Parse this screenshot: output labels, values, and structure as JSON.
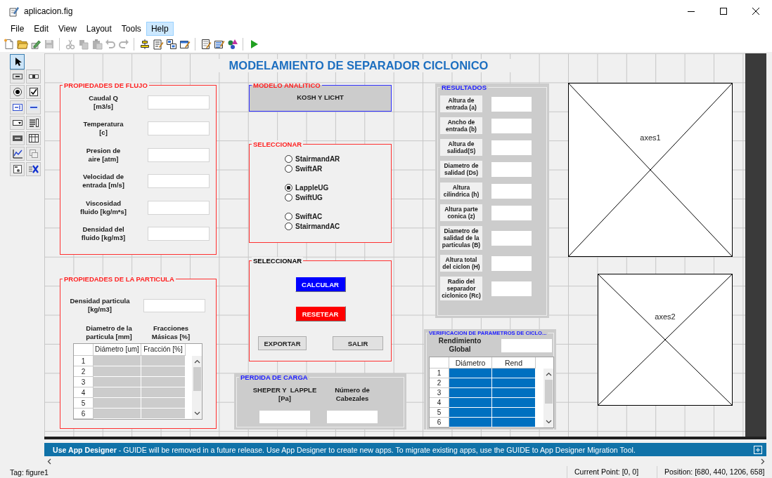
{
  "window": {
    "title": "aplicacion.fig"
  },
  "menu": [
    {
      "label": "File",
      "selected": false
    },
    {
      "label": "Edit",
      "selected": false
    },
    {
      "label": "View",
      "selected": false
    },
    {
      "label": "Layout",
      "selected": false
    },
    {
      "label": "Tools",
      "selected": false
    },
    {
      "label": "Help",
      "selected": true
    }
  ],
  "toolbar": [
    {
      "items": [
        {
          "kind": "new",
          "disabled": false
        },
        {
          "kind": "open",
          "disabled": false
        },
        {
          "kind": "launch",
          "disabled": false
        },
        {
          "kind": "save",
          "disabled": true
        }
      ]
    },
    {
      "items": [
        {
          "kind": "cut",
          "disabled": true
        },
        {
          "kind": "copy",
          "disabled": true
        },
        {
          "kind": "paste",
          "disabled": true
        },
        {
          "kind": "undo",
          "disabled": true
        },
        {
          "kind": "redo",
          "disabled": true
        }
      ]
    },
    {
      "items": [
        {
          "kind": "align",
          "disabled": false
        },
        {
          "kind": "menu",
          "disabled": false
        },
        {
          "kind": "taborder",
          "disabled": false
        },
        {
          "kind": "toolbareditor",
          "disabled": false
        }
      ]
    },
    {
      "items": [
        {
          "kind": "editor",
          "disabled": false
        },
        {
          "kind": "inspector",
          "disabled": false
        },
        {
          "kind": "browser",
          "disabled": false
        }
      ]
    },
    {
      "items": [
        {
          "kind": "run",
          "disabled": false
        }
      ]
    }
  ],
  "palette": [
    {
      "kind": "pointer",
      "selected": true
    },
    {
      "kind": "push",
      "selected": false
    },
    {
      "kind": "slider",
      "selected": false
    },
    {
      "kind": "radio",
      "selected": false
    },
    {
      "kind": "check",
      "selected": false
    },
    {
      "kind": "edit",
      "selected": false
    },
    {
      "kind": "text",
      "selected": false
    },
    {
      "kind": "popup",
      "selected": false
    },
    {
      "kind": "list",
      "selected": false
    },
    {
      "kind": "toggle",
      "selected": false
    },
    {
      "kind": "table",
      "selected": false
    },
    {
      "kind": "axes",
      "selected": false
    },
    {
      "kind": "panel",
      "selected": false
    },
    {
      "kind": "buttongroup",
      "selected": false
    },
    {
      "kind": "activex",
      "selected": false
    }
  ],
  "canvas": {
    "title": "MODELAMIENTO DE SEPARADOR CICLONICO",
    "flow_panel": {
      "title": "PROPIEDADES DE FLUJO",
      "fields": [
        {
          "label": "Caudal Q\n[m3/s]"
        },
        {
          "label": "Temperatura\n[c]"
        },
        {
          "label": "Presion de\naire [atm]"
        },
        {
          "label": "Velocidad de\nentrada [m/s]"
        },
        {
          "label": "Viscosidad\nfluido [kg/m*s]"
        },
        {
          "label": "Densidad del\nfluido [kg/m3]"
        }
      ]
    },
    "particle_panel": {
      "title": "PROPIEDADES DE LA PARTICULA",
      "density_label": "Densidad particula\n[kg/m3]",
      "headings": [
        "Diametro de la\nparticula [mm]",
        "Fracciones\nMásicas [%]"
      ],
      "table": {
        "columns": [
          "Diámetro [um]",
          "Fracción [%]"
        ],
        "rows": [
          "1",
          "2",
          "3",
          "4",
          "5",
          "6"
        ]
      }
    },
    "model_panel": {
      "title": "MODELO ANALITICO",
      "text": "KOSH Y LICHT"
    },
    "method_panel": {
      "title": "SELECCIONAR",
      "groups": [
        {
          "options": [
            {
              "label": "StairmandAR",
              "selected": false
            },
            {
              "label": "SwiftAR",
              "selected": false
            }
          ]
        },
        {
          "options": [
            {
              "label": "LappleUG",
              "selected": true
            },
            {
              "label": "SwiftUG",
              "selected": false
            }
          ]
        },
        {
          "options": [
            {
              "label": "SwiftAC",
              "selected": false
            },
            {
              "label": "StairmandAC",
              "selected": false
            }
          ]
        }
      ]
    },
    "action_panel": {
      "title": "SELECCIONAR",
      "buttons": [
        {
          "label": "CALCULAR",
          "kind": "primary"
        },
        {
          "label": "RESETEAR",
          "kind": "danger"
        },
        {
          "label": "EXPORTAR",
          "kind": "plain"
        },
        {
          "label": "SALIR",
          "kind": "plain"
        }
      ]
    },
    "pressure_panel": {
      "title": "PERDIDA DE CARGA",
      "fields": [
        {
          "label": "SHEPER Y  LAPPLE\n[Pa]"
        },
        {
          "label": "Número de\nCabezales"
        }
      ]
    },
    "results_panel": {
      "title": "RESULTADOS",
      "fields": [
        {
          "label": "Altura de\nentrada (a)"
        },
        {
          "label": "Ancho de\nentrada (b)"
        },
        {
          "label": "Altura de\nsalidad(S)"
        },
        {
          "label": "Diametro de\nsalidad (Ds)"
        },
        {
          "label": "Altura\ncilindrica (h)"
        },
        {
          "label": "Altura parte\nconica (z)"
        },
        {
          "label": "Diametro de\nsalidad de la\nparticulas (B)"
        },
        {
          "label": "Altura total\ndel ciclon (H)"
        },
        {
          "label": "Radio del\nseparador\nciclonico (Rc)"
        }
      ]
    },
    "check_panel": {
      "title": "VERIFICACION  DE PARAMETROS DE CICLO...",
      "label": "Rendimiento\nGlobal",
      "table": {
        "columns": [
          "Diámetro",
          "Rend"
        ],
        "rows": [
          "1",
          "2",
          "3",
          "4",
          "5",
          "6"
        ]
      }
    },
    "axes": [
      {
        "label": "axes1"
      },
      {
        "label": "axes2"
      }
    ]
  },
  "banner": {
    "text": "**Use App Designer** - GUIDE will be removed in a future release. Use App Designer to create new apps. To migrate existing apps, use the GUIDE to App Designer Migration Tool."
  },
  "status_bar": {
    "tag": "Tag: figure1",
    "current_point": "Current Point: [0, 0]",
    "position": "Position: [680, 440, 1206, 658]"
  }
}
